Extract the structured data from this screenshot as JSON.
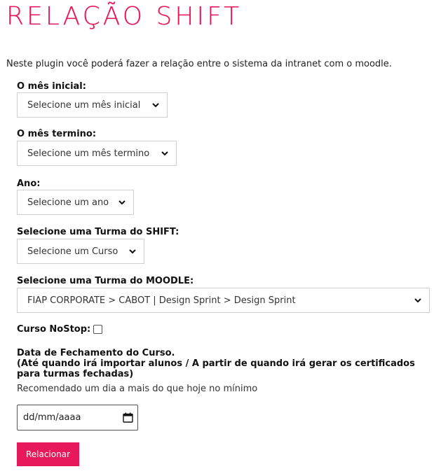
{
  "title": "RELAÇÃO SHIFT",
  "intro": "Neste plugin você poderá fazer a relação entre o sistema da intranet com o moodle.",
  "fields": {
    "mes_inicial": {
      "label": "O mês inicial:",
      "value": "Selecione um mês inicial"
    },
    "mes_termino": {
      "label": "O mês termino:",
      "value": "Selecione um mês termino"
    },
    "ano": {
      "label": "Ano:",
      "value": "Selecione um ano"
    },
    "turma_shift": {
      "label": "Selecione uma Turma do SHIFT:",
      "value": "Selecione um Curso"
    },
    "turma_moodle": {
      "label": "Selecione uma Turma do MOODLE:",
      "value": "FIAP CORPORATE > CABOT | Design Sprint > Design Sprint"
    }
  },
  "nostop": {
    "label": "Curso NoStop:",
    "checked": false
  },
  "fechamento": {
    "title": "Data de Fechamento do Curso.",
    "subtitle": "(Até quando irá importar alunos / A partir de quando irá gerar os certificados para turmas fechadas)",
    "hint": "Recomendado um dia a mais do que hoje no mínimo",
    "placeholder": "dd/mm/aaaa"
  },
  "submit_label": "Relacionar",
  "colors": {
    "accent": "#e8195a"
  }
}
